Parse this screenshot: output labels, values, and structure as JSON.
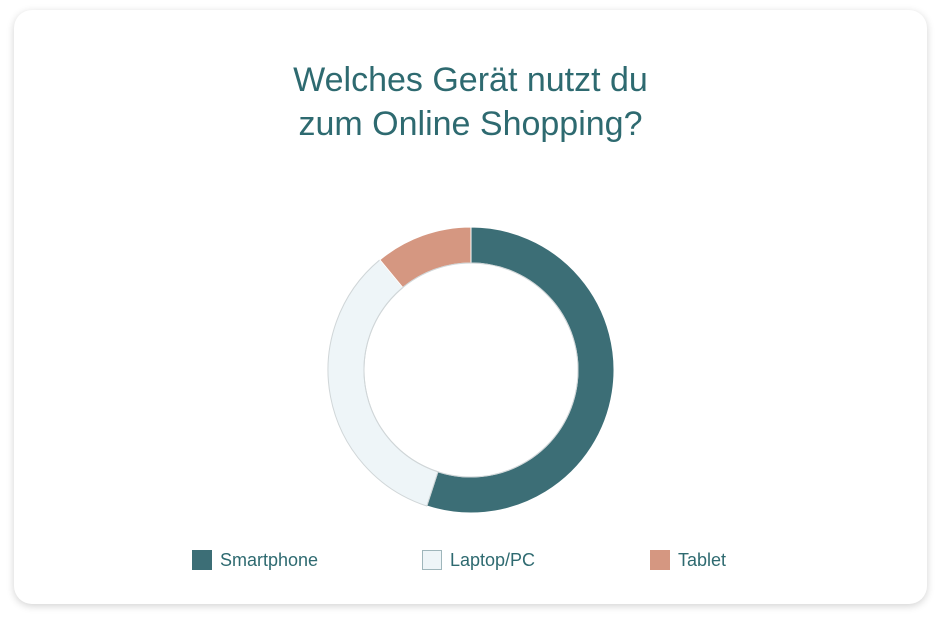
{
  "chart_data": {
    "type": "pie",
    "title_lines": [
      "Welches Gerät nutzt du",
      "zum Online Shopping?"
    ],
    "donut": true,
    "legend_position": "bottom",
    "series": [
      {
        "name": "Smartphone",
        "value": 55,
        "color": "#3c6e76"
      },
      {
        "name": "Laptop/PC",
        "value": 34,
        "color": "#eef5f8"
      },
      {
        "name": "Tablet",
        "value": 11,
        "color": "#d59781"
      }
    ]
  },
  "colors": {
    "text": "#2e6a70",
    "segment_border": "#d0d6d8"
  }
}
